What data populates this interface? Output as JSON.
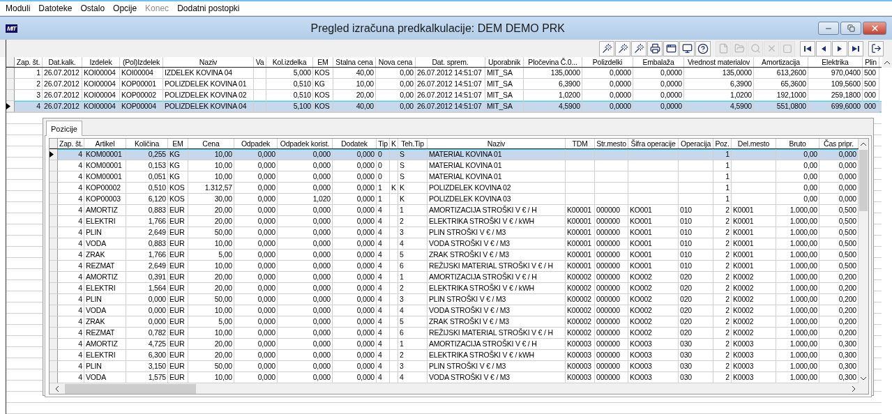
{
  "menu": [
    {
      "label": "Moduli",
      "disabled": false
    },
    {
      "label": "Datoteke",
      "disabled": false
    },
    {
      "label": "Ostalo",
      "disabled": false
    },
    {
      "label": "Opcije",
      "disabled": false
    },
    {
      "label": "Konec",
      "disabled": true
    },
    {
      "label": "Dodatni postopki",
      "disabled": false
    }
  ],
  "window": {
    "logo": "MIT",
    "title": "Pregled izračuna predkalkulacije: DEM DEMO PRK"
  },
  "toolbar": {
    "buttons": [
      {
        "disabled": false
      },
      {
        "disabled": false
      },
      {
        "disabled": false
      },
      {
        "disabled": false
      },
      {
        "disabled": false
      },
      {
        "disabled": false
      },
      {
        "disabled": false
      },
      {
        "disabled": true
      },
      {
        "disabled": true
      },
      {
        "disabled": true
      },
      {
        "disabled": true
      },
      {
        "disabled": true
      },
      {
        "disabled": false
      },
      {
        "disabled": false
      },
      {
        "disabled": false
      },
      {
        "disabled": false
      },
      {
        "disabled": false
      }
    ]
  },
  "top_table": {
    "columns": [
      "Zap. št.",
      "Dat.kalk.",
      "Izdelek",
      "(Pol)Izdelek",
      "Naziv",
      "Va",
      "Kol.izdelka",
      "EM",
      "Stalna cena",
      "Nova cena",
      "Dat. sprem.",
      "Uporabnik",
      "Pločevina Č.0...",
      "Polizdelki",
      "Embalaža",
      "Vrednost materialov",
      "Amortizacija",
      "Elektrika",
      "Plin"
    ],
    "rows": [
      {
        "selected": false,
        "cells": [
          "1",
          "26.07.2012",
          "KOI00004",
          "KOI00004",
          "IZDELEK KOVINA 04",
          null,
          "5,000",
          "KOS",
          "40,00",
          "0,00",
          "26.07.2012 14:51:07",
          "MIT_SA",
          "135,0000",
          "0,0000",
          "0,0000",
          "135,0000",
          "613,2600",
          "970,0400",
          "500"
        ]
      },
      {
        "selected": false,
        "cells": [
          "2",
          "26.07.2012",
          "KOI00004",
          "KOP00001",
          "POLIZDELEK KOVINA 01",
          null,
          "0,510",
          "KG",
          "10,00",
          "0,00",
          "26.07.2012 14:51:07",
          "MIT_SA",
          "6,3900",
          "0,0000",
          "0,0000",
          "6,3900",
          "65,3600",
          "109,5600",
          "500"
        ]
      },
      {
        "selected": false,
        "cells": [
          "3",
          "26.07.2012",
          "KOI00004",
          "KOP00002",
          "POLIZDELEK KOVINA 02",
          null,
          "0,510",
          "KOS",
          "20,00",
          "0,00",
          "26.07.2012 14:51:07",
          "MIT_SA",
          "1,0200",
          "0,0000",
          "0,0000",
          "1,0200",
          "192,1000",
          "259,1800",
          "000"
        ]
      },
      {
        "selected": true,
        "cells": [
          "4",
          "26.07.2012",
          "KOI00004",
          "KOP00004",
          "POLIZDELEK KOVINA 04",
          null,
          "5,100",
          "KOS",
          "40,00",
          "0,00",
          "26.07.2012 14:51:07",
          "MIT_SA",
          "4,5900",
          "0,0000",
          "0,0000",
          "4,5900",
          "551,0800",
          "699,6000",
          "000"
        ]
      }
    ]
  },
  "tabs": [
    {
      "label": "Pozicije",
      "selected": true
    }
  ],
  "positions_table": {
    "columns": [
      "Zap. št.",
      "Artikel",
      "Količina",
      "EM",
      "Cena",
      "Odpadek",
      "Odpadek korist.",
      "Dodatek",
      "Tip",
      "K",
      "Teh.Tip",
      "Naziv",
      "TDM",
      "Str.mesto",
      "Šifra operacije",
      "Operacija",
      "Poz.",
      "Del.mesto",
      "Bruto",
      "Čas pripr."
    ],
    "rows": [
      {
        "selected": true,
        "cells": [
          "4",
          "KOM00001",
          "0,255",
          "KG",
          "10,00",
          "0,000",
          "0,000",
          "0,000",
          "0",
          null,
          "S",
          "MATERIAL KOVINA 01",
          null,
          null,
          null,
          null,
          "1",
          null,
          "0,00",
          "0,000"
        ]
      },
      {
        "selected": false,
        "cells": [
          "4",
          "KOM00001",
          "0,153",
          "KG",
          "10,00",
          "0,000",
          "0,000",
          "0,000",
          "0",
          null,
          "S",
          "MATERIAL KOVINA 01",
          null,
          null,
          null,
          null,
          "1",
          null,
          "0,00",
          "0,000"
        ]
      },
      {
        "selected": false,
        "cells": [
          "4",
          "KOM00001",
          "0,051",
          "KG",
          "10,00",
          "0,000",
          "0,000",
          "0,000",
          "0",
          null,
          "S",
          "MATERIAL KOVINA 01",
          null,
          null,
          null,
          null,
          "1",
          null,
          "0,00",
          "0,000"
        ]
      },
      {
        "selected": false,
        "cells": [
          "4",
          "KOP00002",
          "0,510",
          "KOS",
          "1.312,57",
          "0,000",
          "0,000",
          "0,000",
          "1",
          "K",
          "K",
          "POLIZDELEK KOVINA 02",
          null,
          null,
          null,
          null,
          "1",
          null,
          "0,00",
          "0,000"
        ]
      },
      {
        "selected": false,
        "cells": [
          "4",
          "KOP00003",
          "6,120",
          "KOS",
          "30,00",
          "0,000",
          "1,020",
          "0,000",
          "1",
          null,
          "K",
          "POLIZDELEK KOVINA 03",
          null,
          null,
          null,
          null,
          "1",
          null,
          "0,00",
          "0,000"
        ]
      },
      {
        "selected": false,
        "cells": [
          "4",
          "AMORTIZ",
          "0,883",
          "EUR",
          "20,00",
          "0,000",
          "0,000",
          "0,000",
          "4",
          null,
          "1",
          "AMORTIZACIJA STROŠKI V € / H",
          "K00001",
          "000000",
          "KO001",
          "010",
          "2",
          "K0001",
          "1.000,00",
          "0,500"
        ]
      },
      {
        "selected": false,
        "cells": [
          "4",
          "ELEKTRI",
          "1,766",
          "EUR",
          "20,00",
          "0,000",
          "0,000",
          "0,000",
          "4",
          null,
          "2",
          "ELEKTRIKA STROŠKI V € / kWH",
          "K00001",
          "000000",
          "KO001",
          "010",
          "2",
          "K0001",
          "1.000,00",
          "0,500"
        ]
      },
      {
        "selected": false,
        "cells": [
          "4",
          "PLIN",
          "2,649",
          "EUR",
          "50,00",
          "0,000",
          "0,000",
          "0,000",
          "4",
          null,
          "3",
          "PLIN STROŠKI V € / M3",
          "K00001",
          "000000",
          "KO001",
          "010",
          "2",
          "K0001",
          "1.000,00",
          "0,500"
        ]
      },
      {
        "selected": false,
        "cells": [
          "4",
          "VODA",
          "0,883",
          "EUR",
          "10,00",
          "0,000",
          "0,000",
          "0,000",
          "4",
          null,
          "4",
          "VODA STROŠKI V € / M3",
          "K00001",
          "000000",
          "KO001",
          "010",
          "2",
          "K0001",
          "1.000,00",
          "0,500"
        ]
      },
      {
        "selected": false,
        "cells": [
          "4",
          "ZRAK",
          "1,766",
          "EUR",
          "5,00",
          "0,000",
          "0,000",
          "0,000",
          "4",
          null,
          "5",
          "ZRAK STROŠKI V € / M3",
          "K00001",
          "000000",
          "KO001",
          "010",
          "2",
          "K0001",
          "1.000,00",
          "0,500"
        ]
      },
      {
        "selected": false,
        "cells": [
          "4",
          "REZMAT",
          "2,649",
          "EUR",
          "10,00",
          "0,000",
          "0,000",
          "0,000",
          "4",
          null,
          "6",
          "REŽIJSKI MATERIAL STROŠKI V € / H",
          "K00001",
          "000000",
          "KO001",
          "010",
          "2",
          "K0001",
          "1.000,00",
          "0,500"
        ]
      },
      {
        "selected": false,
        "cells": [
          "4",
          "AMORTIZ",
          "0,391",
          "EUR",
          "20,00",
          "0,000",
          "0,000",
          "0,000",
          "4",
          null,
          "1",
          "AMORTIZACIJA STROŠKI V € / H",
          "K00002",
          "000000",
          "KO002",
          "020",
          "2",
          "K0002",
          "1.000,00",
          "0,200"
        ]
      },
      {
        "selected": false,
        "cells": [
          "4",
          "ELEKTRI",
          "1,564",
          "EUR",
          "20,00",
          "0,000",
          "0,000",
          "0,000",
          "4",
          null,
          "2",
          "ELEKTRIKA STROŠKI V € / kWH",
          "K00002",
          "000000",
          "KO002",
          "020",
          "2",
          "K0002",
          "1.000,00",
          "0,200"
        ]
      },
      {
        "selected": false,
        "cells": [
          "4",
          "PLIN",
          "0,000",
          "EUR",
          "50,00",
          "0,000",
          "0,000",
          "0,000",
          "4",
          null,
          "3",
          "PLIN STROŠKI V € / M3",
          "K00002",
          "000000",
          "KO002",
          "020",
          "2",
          "K0002",
          "1.000,00",
          "0,200"
        ]
      },
      {
        "selected": false,
        "cells": [
          "4",
          "VODA",
          "0,000",
          "EUR",
          "10,00",
          "0,000",
          "0,000",
          "0,000",
          "4",
          null,
          "4",
          "VODA STROŠKI V € / M3",
          "K00002",
          "000000",
          "KO002",
          "020",
          "2",
          "K0002",
          "1.000,00",
          "0,200"
        ]
      },
      {
        "selected": false,
        "cells": [
          "4",
          "ZRAK",
          "0,000",
          "EUR",
          "5,00",
          "0,000",
          "0,000",
          "0,000",
          "4",
          null,
          "5",
          "ZRAK STROŠKI V € / M3",
          "K00002",
          "000000",
          "KO002",
          "020",
          "2",
          "K0002",
          "1.000,00",
          "0,200"
        ]
      },
      {
        "selected": false,
        "cells": [
          "4",
          "REZMAT",
          "0,782",
          "EUR",
          "10,00",
          "0,000",
          "0,000",
          "0,000",
          "4",
          null,
          "6",
          "REŽIJSKI MATERIAL STROŠKI V € / H",
          "K00002",
          "000000",
          "KO002",
          "020",
          "2",
          "K0002",
          "1.000,00",
          "0,200"
        ]
      },
      {
        "selected": false,
        "cells": [
          "4",
          "AMORTIZ",
          "4,725",
          "EUR",
          "20,00",
          "0,000",
          "0,000",
          "0,000",
          "4",
          null,
          "1",
          "AMORTIZACIJA STROŠKI V € / H",
          "K00003",
          "000000",
          "KO003",
          "030",
          "2",
          "K0003",
          "1.000,00",
          "0,300"
        ]
      },
      {
        "selected": false,
        "cells": [
          "4",
          "ELEKTRI",
          "6,300",
          "EUR",
          "20,00",
          "0,000",
          "0,000",
          "0,000",
          "4",
          null,
          "2",
          "ELEKTRIKA STROŠKI V € / kWH",
          "K00003",
          "000000",
          "KO003",
          "030",
          "2",
          "K0003",
          "1.000,00",
          "0,300"
        ]
      },
      {
        "selected": false,
        "cells": [
          "4",
          "PLIN",
          "3,150",
          "EUR",
          "50,00",
          "0,000",
          "0,000",
          "0,000",
          "4",
          null,
          "3",
          "PLIN STROŠKI V € / M3",
          "K00003",
          "000000",
          "KO003",
          "030",
          "2",
          "K0003",
          "1.000,00",
          "0,300"
        ]
      },
      {
        "selected": false,
        "cells": [
          "4",
          "VODA",
          "1,575",
          "EUR",
          "10,00",
          "0,000",
          "0,000",
          "0,000",
          "4",
          null,
          "4",
          "VODA STROŠKI V € / M3",
          "K00003",
          "000000",
          "KO003",
          "030",
          "2",
          "K0003",
          "1.000,00",
          "0,300"
        ]
      }
    ]
  }
}
